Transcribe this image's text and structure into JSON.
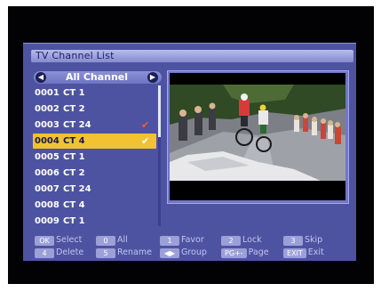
{
  "window": {
    "title": "TV Channel List"
  },
  "group": {
    "label": "All Channel",
    "prev_icon": "left-arrow-icon",
    "next_icon": "right-arrow-icon"
  },
  "channels": [
    {
      "num": "0001",
      "name": "CT 1",
      "fav": ""
    },
    {
      "num": "0002",
      "name": "CT 2",
      "fav": ""
    },
    {
      "num": "0003",
      "name": "CT 24",
      "fav": "✔"
    },
    {
      "num": "0004",
      "name": "CT 4",
      "fav": "✔"
    },
    {
      "num": "0005",
      "name": "CT 1",
      "fav": ""
    },
    {
      "num": "0006",
      "name": "CT 2",
      "fav": ""
    },
    {
      "num": "0007",
      "name": "CT 24",
      "fav": ""
    },
    {
      "num": "0008",
      "name": "CT 4",
      "fav": ""
    },
    {
      "num": "0009",
      "name": "CT 1",
      "fav": ""
    }
  ],
  "selected_index": 3,
  "legend": [
    {
      "key": "OK",
      "label": "Select"
    },
    {
      "key": "0",
      "label": "All"
    },
    {
      "key": "1",
      "label": "Favor"
    },
    {
      "key": "2",
      "label": "Lock"
    },
    {
      "key": "3",
      "label": "Skip"
    },
    {
      "key": "4",
      "label": "Delete"
    },
    {
      "key": "5",
      "label": "Rename"
    },
    {
      "key": "◀▶",
      "label": "Group"
    },
    {
      "key": "PG+-",
      "label": "Page"
    },
    {
      "key": "EXIT",
      "label": "Exit"
    }
  ],
  "colors": {
    "panel": "#4e53a1",
    "highlight": "#f2c233",
    "favorite_mark": "#ff5a1e"
  }
}
